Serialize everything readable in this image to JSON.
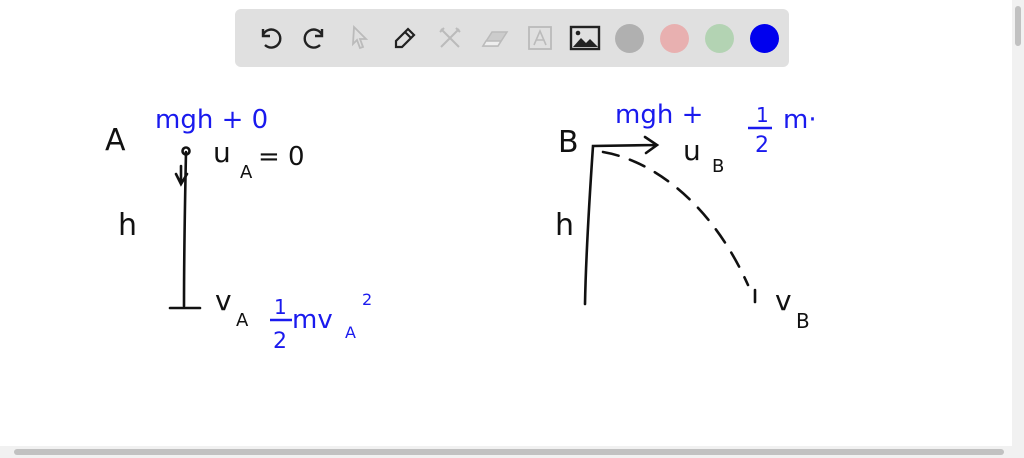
{
  "toolbar": {
    "tools": [
      "undo-icon",
      "redo-icon",
      "select-icon",
      "pen-icon",
      "tools-icon",
      "eraser-icon",
      "text-icon",
      "image-icon"
    ],
    "colors": [
      "#b0b0b0",
      "#e8b0b0",
      "#b0d0b0",
      "#0000ee"
    ],
    "selected_color": "#0000ee"
  },
  "board": {
    "left": {
      "label": "A",
      "energy_top": "mgh + 0",
      "velocity_top": "u",
      "velocity_top_sub": "A",
      "velocity_top_value": "= 0",
      "height": "h",
      "velocity_bottom": "v",
      "velocity_bottom_sub": "A",
      "ke_num": "1",
      "ke_den": "2",
      "ke_body": "mv",
      "ke_sub": "A",
      "ke_exp": "2"
    },
    "right": {
      "label": "B",
      "energy_top": "mgh +",
      "ke_num": "1",
      "ke_den": "2",
      "ke_body": "m·",
      "velocity_top": "u",
      "velocity_top_sub": "B",
      "height": "h",
      "velocity_bottom": "v",
      "velocity_bottom_sub": "B"
    },
    "ink_color": "#000000",
    "accent_color": "#1a1aee"
  }
}
